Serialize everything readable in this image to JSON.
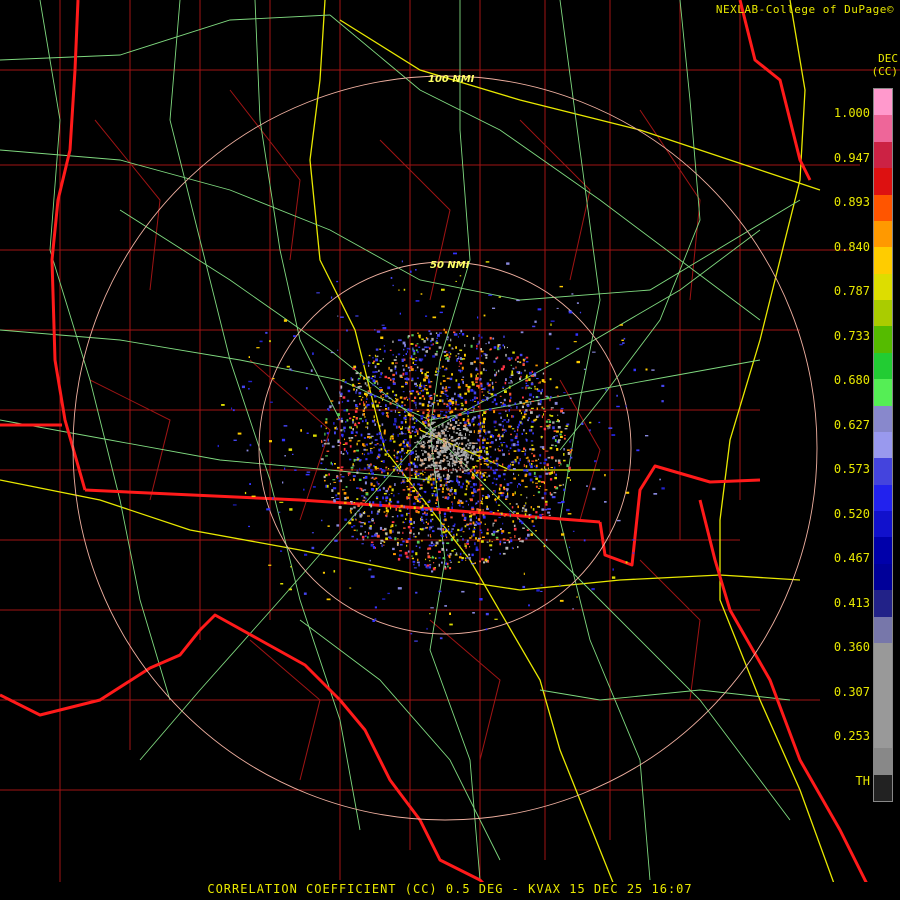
{
  "credit": "NEXLAB-College of DuPage",
  "credit_logo": "©",
  "unit_lines": [
    "DEC",
    "(CC)"
  ],
  "scale_labels": [
    "1.000",
    "0.947",
    "0.893",
    "0.840",
    "0.787",
    "0.733",
    "0.680",
    "0.627",
    "0.573",
    "0.520",
    "0.467",
    "0.413",
    "0.360",
    "0.307",
    "0.253",
    "TH"
  ],
  "colorbar_colors": [
    "#ff99cc",
    "#ee6699",
    "#cc2244",
    "#dd1111",
    "#ff5500",
    "#ff9900",
    "#ffcc00",
    "#dddd00",
    "#aacc00",
    "#55bb00",
    "#22cc33",
    "#55ee55",
    "#8888cc",
    "#9999ee",
    "#4444dd",
    "#2222ee",
    "#1111cc",
    "#0000aa",
    "#000099",
    "#222288",
    "#7777aa",
    "#999999",
    "#999999",
    "#999999",
    "#999999",
    "#888888",
    "#222222"
  ],
  "ring_labels": [
    "100 NMI",
    "50 NMI"
  ],
  "title": "CORRELATION COEFFICIENT (CC) 0.5 DEG - KVAX 15 DEC 25 16:07",
  "colors": {
    "state_border": "#ff1a1a",
    "county_border": "#a01414",
    "highway": "#e8e800",
    "road": "#7fd97f",
    "range_ring": "#f0b0a0",
    "text": "#e8e800"
  }
}
